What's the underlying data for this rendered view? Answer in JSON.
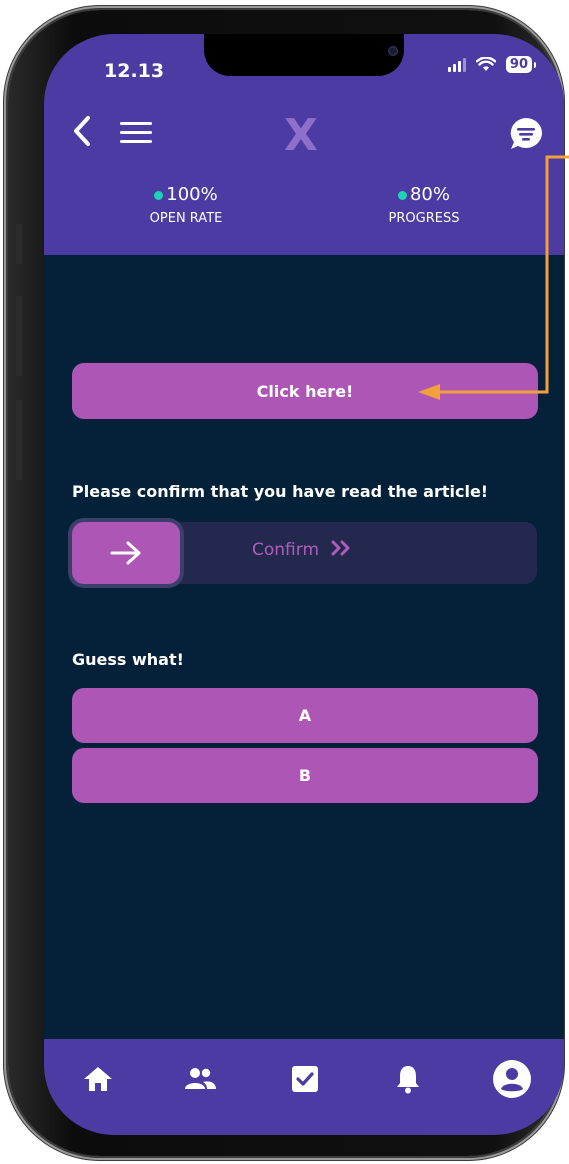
{
  "status_bar": {
    "time": "12.13",
    "battery": "90"
  },
  "header": {
    "logo_letter": "X"
  },
  "stats": [
    {
      "value": "100%",
      "label": "OPEN RATE"
    },
    {
      "value": "80%",
      "label": "PROGRESS"
    }
  ],
  "click_button": {
    "label": "Click here!"
  },
  "confirm_section": {
    "prompt": "Please confirm that you have read the article!",
    "slider_label": "Confirm"
  },
  "guess_section": {
    "title": "Guess what!",
    "options": [
      "A",
      "B"
    ]
  },
  "icons": {
    "back": "chevron-left-icon",
    "menu": "hamburger-icon",
    "chat": "chat-bubble-icon",
    "tabs": [
      "home-icon",
      "people-icon",
      "checkbox-icon",
      "bell-icon",
      "profile-icon"
    ]
  },
  "colors": {
    "header": "#4b3ba2",
    "background": "#05213a",
    "button": "#ad56b5",
    "accent_dot": "#1ed2b4",
    "callout": "#f2a13c"
  }
}
